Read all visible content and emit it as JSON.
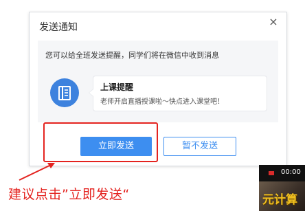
{
  "dialog": {
    "title": "发送通知",
    "close_glyph": "×",
    "message": "您可以给全班发送提醒，同学们将在微信中收到消息",
    "icon_name": "book-icon",
    "notification": {
      "title": "上课提醒",
      "text": "老师开启直播授课啦～快点进入课堂吧！"
    },
    "buttons": {
      "confirm": "立即发送",
      "cancel": "暂不发送"
    }
  },
  "annotation": {
    "text": "建议点击”立即发送“",
    "color": "#e4231f"
  },
  "thumbnail": {
    "time_text": "00:00"
  },
  "watermark": {
    "text": "元计算"
  },
  "colors": {
    "primary": "#3d8ef0",
    "icon_bg": "#3d82de",
    "highlight": "#e4231f"
  }
}
